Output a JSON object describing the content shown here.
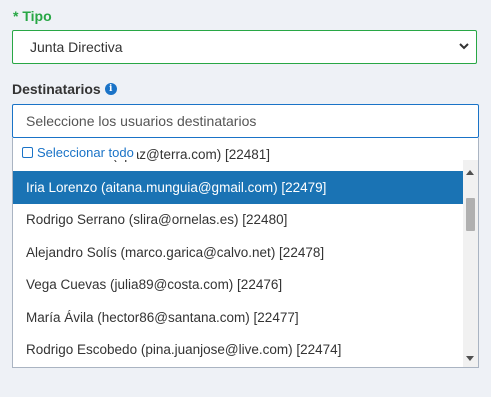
{
  "tipo": {
    "label": "* Tipo",
    "selected": "Junta Directiva"
  },
  "destinatarios": {
    "label": "Destinatarios",
    "info_icon": "info-circle-icon",
    "search_placeholder": "Seleccione los usuarios destinatarios",
    "select_all_label": "Seleccionar todo",
    "items": [
      {
        "text": "Adam Llamas (opaz@terra.com) [22481]",
        "highlighted": false
      },
      {
        "text": "Iria Lorenzo (aitana.munguia@gmail.com) [22479]",
        "highlighted": true
      },
      {
        "text": "Rodrigo Serrano (slira@ornelas.es) [22480]",
        "highlighted": false
      },
      {
        "text": "Alejandro Solís (marco.garica@calvo.net) [22478]",
        "highlighted": false
      },
      {
        "text": "Vega Cuevas (julia89@costa.com) [22476]",
        "highlighted": false
      },
      {
        "text": "María Ávila (hector86@santana.com) [22477]",
        "highlighted": false
      },
      {
        "text": "Rodrigo Escobedo (pina.juanjose@live.com) [22474]",
        "highlighted": false
      }
    ]
  },
  "colors": {
    "required_label": "#28a745",
    "accent": "#1a73c7",
    "highlight": "#1a73b4",
    "background": "#eef1f6"
  }
}
